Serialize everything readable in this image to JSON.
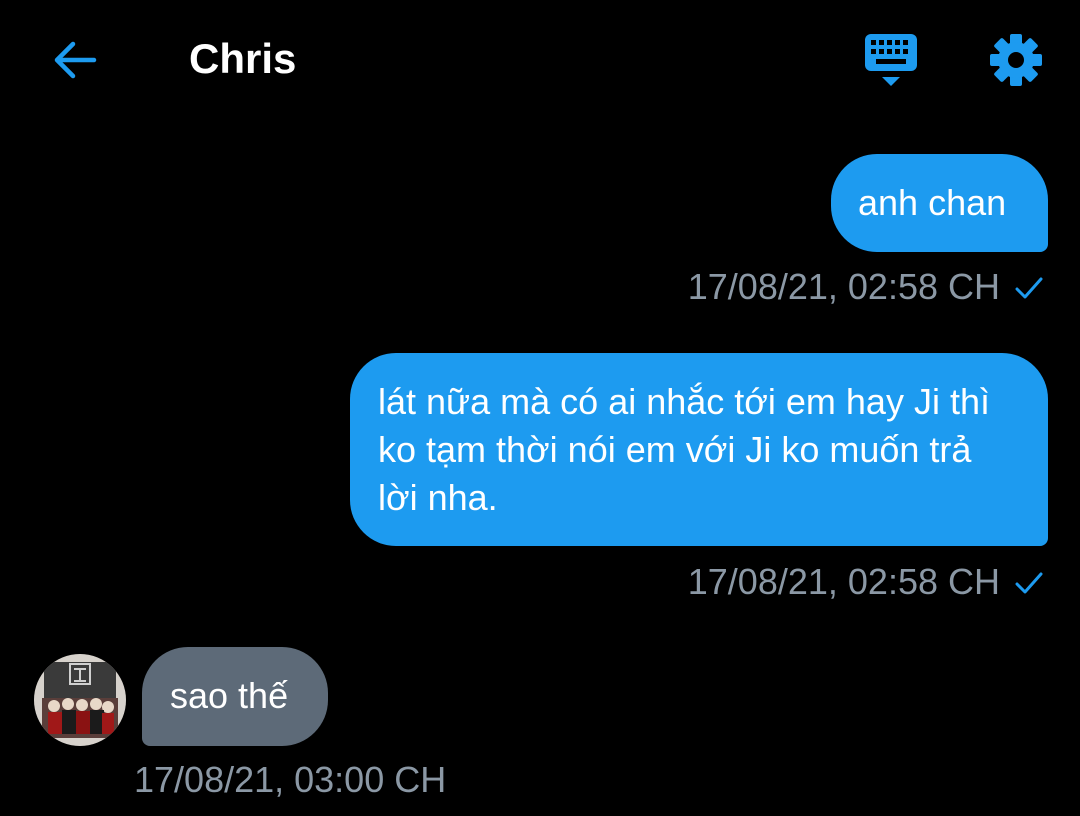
{
  "header": {
    "back_icon": "arrow-left-icon",
    "title": "Chris",
    "keyboard_icon": "keyboard-icon",
    "settings_icon": "gear-icon"
  },
  "colors": {
    "background": "#000000",
    "accent": "#1d9bf0",
    "incoming_bubble": "#5d6a78",
    "meta_text": "#8b98a5"
  },
  "messages": [
    {
      "direction": "outgoing",
      "text": "anh chan",
      "timestamp": "17/08/21, 02:58 CH",
      "status_icon": "check-icon"
    },
    {
      "direction": "outgoing",
      "text": "lát nữa mà có ai nhắc tới em hay Ji thì ko tạm thời nói em với Ji ko muốn trả lời nha.",
      "timestamp": "17/08/21, 02:58 CH",
      "status_icon": "check-icon"
    },
    {
      "direction": "incoming",
      "text": "sao thế",
      "timestamp": "17/08/21, 03:00 CH",
      "avatar_icon": "avatar"
    }
  ]
}
